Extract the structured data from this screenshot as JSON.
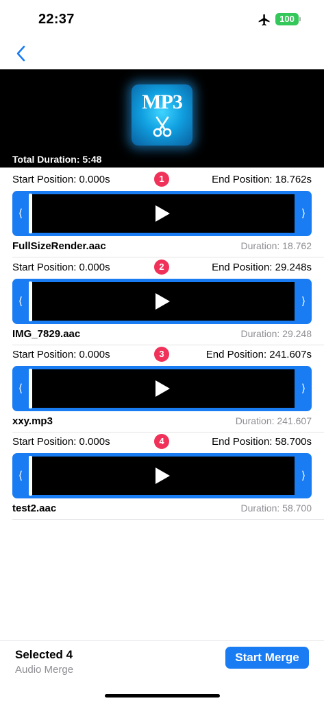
{
  "status_bar": {
    "time": "22:37",
    "battery": "100"
  },
  "header": {
    "logo_text": "MP3",
    "total_duration": "Total Duration: 5:48"
  },
  "tracks": [
    {
      "index": "1",
      "start": "Start Position: 0.000s",
      "end": "End Position: 18.762s",
      "filename": "FullSizeRender.aac",
      "duration": "Duration: 18.762"
    },
    {
      "index": "2",
      "start": "Start Position: 0.000s",
      "end": "End Position: 29.248s",
      "filename": "IMG_7829.aac",
      "duration": "Duration: 29.248"
    },
    {
      "index": "3",
      "start": "Start Position: 0.000s",
      "end": "End Position: 241.607s",
      "filename": "xxy.mp3",
      "duration": "Duration: 241.607"
    },
    {
      "index": "4",
      "start": "Start Position: 0.000s",
      "end": "End Position: 58.700s",
      "filename": "test2.aac",
      "duration": "Duration: 58.700"
    }
  ],
  "trimmer": {
    "left_handle": "⟨",
    "right_handle": "⟩"
  },
  "bottom": {
    "selected": "Selected 4",
    "subtitle": "Audio Merge",
    "merge_label": "Start Merge"
  },
  "colors": {
    "accent": "#1a7cf3",
    "badge": "#f0325a",
    "battery": "#34c759",
    "secondary_text": "#8e8e93"
  },
  "icons": {
    "back": "chevron-left-icon",
    "airplane": "airplane-icon",
    "play": "play-icon",
    "scissors": "scissors-icon"
  }
}
